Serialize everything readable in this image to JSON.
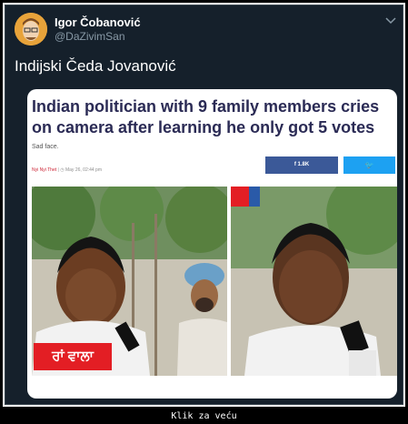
{
  "tweet": {
    "author_name": "Igor Čobanović",
    "author_handle": "@DaZivimSan",
    "text": "Indijski Čeda Jovanović",
    "chevron_icon": "chevron-down-icon"
  },
  "article": {
    "headline": "Indian politician with 9 family members cries on camera after learning he only got 5 votes",
    "subtitle": "Sad face.",
    "author": "Nyi Nyi Thet",
    "date": "May 26, 02:44 pm",
    "facebook_count": "1.8K",
    "photo_caption_overlay": "ਰਾਂ ਵਾਲਾ"
  },
  "footer": {
    "link_text": "Klik za veću"
  },
  "colors": {
    "page_bg": "#000000",
    "tweet_bg": "#15202b",
    "headline": "#2b2b55",
    "facebook": "#3b5998",
    "twitter": "#1da1f2",
    "overlay_red": "#e31e24"
  }
}
